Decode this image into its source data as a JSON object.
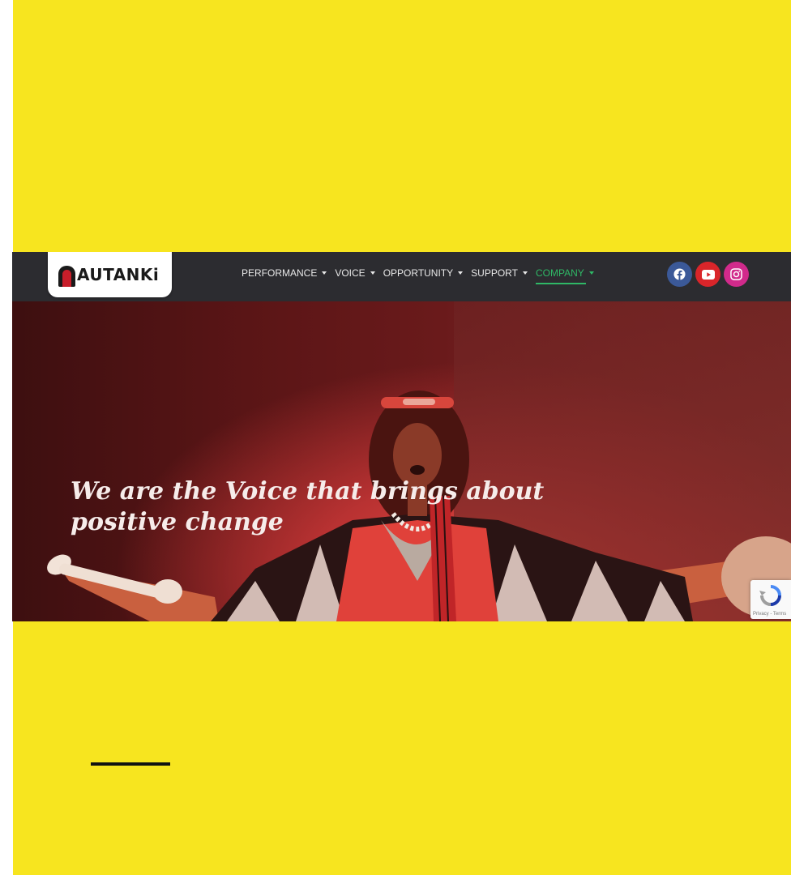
{
  "colors": {
    "background": "#f7e51f",
    "navbar": "#2c2c30",
    "active_nav": "#2fb866",
    "facebook": "#3b5998",
    "youtube": "#d9252a",
    "instagram": "#d12a8b"
  },
  "logo": {
    "text": "AUTANKi"
  },
  "nav": {
    "items": [
      {
        "label": "PERFORMANCE",
        "active": false
      },
      {
        "label": "VOICE",
        "active": false
      },
      {
        "label": "OPPORTUNITY",
        "active": false
      },
      {
        "label": "SUPPORT",
        "active": false
      },
      {
        "label": "COMPANY",
        "active": true
      }
    ]
  },
  "social": {
    "icons": [
      "facebook-icon",
      "youtube-icon",
      "instagram-icon"
    ]
  },
  "hero": {
    "headline_line1": "We are the Voice that brings about",
    "headline_line2": "positive change"
  },
  "recaptcha": {
    "label": "Privacy - Terms"
  }
}
